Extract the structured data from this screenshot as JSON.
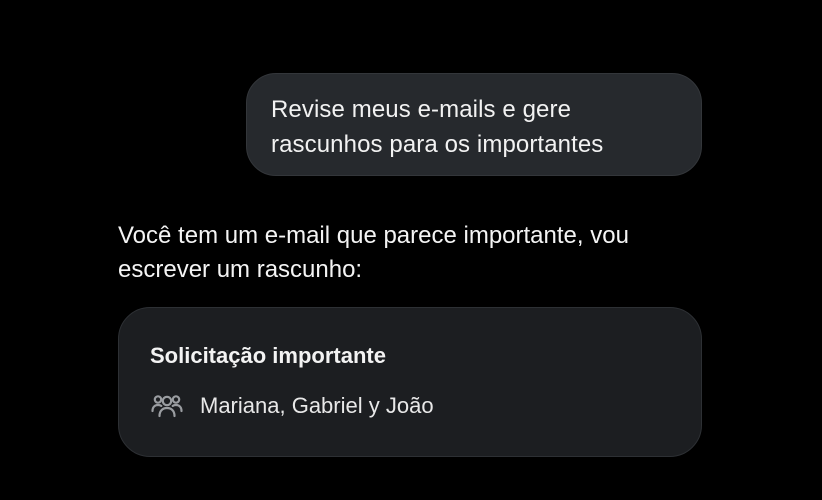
{
  "conversation": {
    "user_message": "Revise meus e-mails e gere rascunhos para os importantes",
    "assistant_message": "Você tem um e-mail que parece importante, vou escrever um rascunho:"
  },
  "email_card": {
    "title": "Solicitação importante",
    "recipients": "Mariana, Gabriel y João",
    "icon": "people-icon"
  },
  "colors": {
    "background": "#000000",
    "user_bubble": "#26292d",
    "card": "#1c1e21",
    "text": "#f2f2f2"
  }
}
